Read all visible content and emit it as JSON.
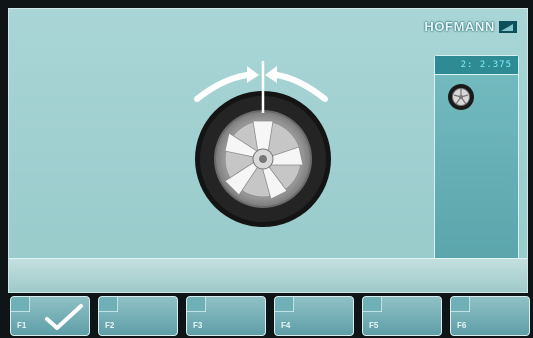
{
  "brand": {
    "name": "HOFMANN"
  },
  "side_panel": {
    "readout": "2: 2.375"
  },
  "function_keys": [
    {
      "label": "F1",
      "icon": "check-icon"
    },
    {
      "label": "F2",
      "icon": ""
    },
    {
      "label": "F3",
      "icon": ""
    },
    {
      "label": "F4",
      "icon": ""
    },
    {
      "label": "F5",
      "icon": ""
    },
    {
      "label": "F6",
      "icon": ""
    }
  ],
  "colors": {
    "background": "#a9d5d6",
    "readout": "#7ff2ff",
    "key": "#5f9ea7"
  }
}
